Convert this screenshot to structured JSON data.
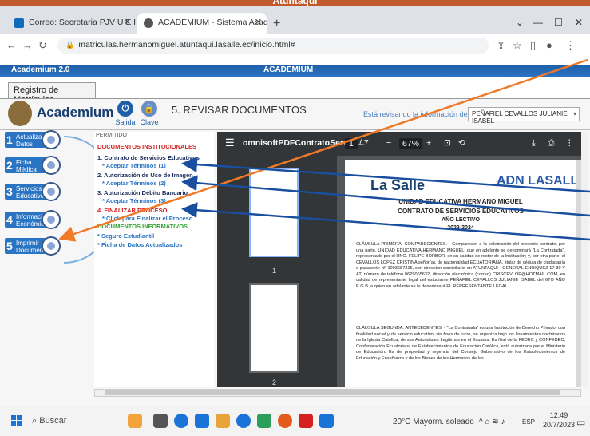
{
  "banner": {
    "title": "Atuntaqui"
  },
  "browser": {
    "tabs": [
      {
        "label": "Correo: Secretaria PJV U E Herma",
        "favicon_color": "#0f6cbd"
      },
      {
        "label": "ACADEMIUM - Sistema Academ",
        "favicon_color": "#555555"
      }
    ],
    "url": "matriculas.hermanomiguel.atuntaqui.lasalle.ec/inicio.html#",
    "window": {
      "min": "—",
      "max": "☐",
      "close": "✕",
      "chevron": "⌄"
    }
  },
  "app": {
    "bar_left": "Academium 2.0",
    "bar_center": "ACADEMIUM",
    "module_tab": "Registro de Matrículas",
    "logo": "Academium",
    "salida": "Salida",
    "clave": "Clave",
    "section_title": "5. REVISAR DOCUMENTOS",
    "revision_label": "Está revisando la información de:",
    "student": "PEÑAFIEL CEVALLOS JULIANIE ISABEL"
  },
  "steps": [
    {
      "num": "1",
      "label": "Actualizar Datos"
    },
    {
      "num": "2",
      "label": "Ficha Médica"
    },
    {
      "num": "3",
      "label": "Servicios Educativos"
    },
    {
      "num": "4",
      "label": "Información Económica"
    },
    {
      "num": "5",
      "label": "Imprimir Documentos"
    }
  ],
  "permit": {
    "label": "PERMITIDO",
    "inst_header": "DOCUMENTOS INSTITUCIONALES",
    "doc1": "1. Contrato de Servicios Educativos",
    "doc1_link": "* Aceptar Términos (1)",
    "doc2": "2. Autorización de Uso de Imagen",
    "doc2_link": "* Aceptar Términos (2)",
    "doc3": "3. Autorización Débito Bancario",
    "doc3_link": "* Aceptar Términos (3)",
    "doc4": "4. FINALIZAR PROCESO",
    "doc4_link": "* Click para Finalizar el Proceso",
    "info_header": "DOCUMENTOS INFORMATIVOS",
    "info1": "* Seguro Estudiantil",
    "info2": "* Ficha de Datos Actualizados"
  },
  "pdf": {
    "filename": "omnisoftPDFContratoServici...",
    "page": "1",
    "pages": "/ 7",
    "zoom": "67%",
    "thumb1": "1",
    "thumb2": "2",
    "logo_left": "La Salle",
    "logo_right": "ADN LASALLISTA",
    "school": "UNIDAD EDUCATIVA HERMANO MIGUEL",
    "contract": "CONTRATO DE SERVICIOS EDUCATIVOS",
    "year_label": "AÑO LECTIVO",
    "year": "2023-2024",
    "clause1": "CLÁUSULA PRIMERA: COMPARECIENTES. - Comparecen a la celebración del presente contrato, por una parte, UNIDAD EDUCATIVA HERMANO MIGUEL, que en adelante se denominará \"La Contratada\", representado por el HNO. FELIPE BORBOR, en su calidad de rector de la Institución; y, por otra parte, el CEVALLOS LOPEZ CRISTINA señor(a), de nacionalidad ECUATORIANA, titular de cédula de ciudadanía o pasaporte Nº 1003687315, con dirección domiciliaria en ATUNTAQUI - GENERAL ENRIQUEZ 17-39 Y AT, número de teléfono 0629065632, dirección electrónica (correo) CRISCEVLOP@HOTMAIL.COM, en calidad de representante legal del estudiante PEÑAFIEL CEVALLOS JULIANIE ISABEL del 6TO AÑO E.G.B. a quien en adelante se le denominará EL REPRESENTANTE LEGAL.",
    "clause2": "CLÁUSULA SEGUNDA: ANTECEDENTES. - \"La Contratada\" es una Institución de Derecho Privado, con finalidad social y de servicio educativo, sin fines de lucro, se organiza bajo los lineamientos doctrinarios de la Iglesia Católica, de sus Autoridades Legítimas en el Ecuador. Es filial de la FEDEC y CONFEDEC, Confederación Ecuatoriana de Establecimientos de Educación Católica, está autorizada por el Ministerio de Educación. Es de propiedad y regencia del Consejo Gubernativo de los Establecimientos de Educación y Enseñanza y de los Bienes de los Hermanos de las"
  },
  "taskbar": {
    "search": "Buscar",
    "weather": "20°C  Mayorm. soleado",
    "tray": "^ ⌂ ≋ ♪",
    "lang": "ESP",
    "time": "12:49",
    "date": "20/7/2023",
    "icons": [
      "#f2a33a",
      "#555555",
      "#1a73d6",
      "#1a73d6",
      "#e8a33a",
      "#1a73d6",
      "#2a9e5a",
      "#e45a1a",
      "#d62020",
      "#1a73d6"
    ]
  },
  "colors": {
    "accent": "#2a74c4",
    "arrow_orange": "#f07a28",
    "arrow_blue": "#1a4fa0"
  }
}
